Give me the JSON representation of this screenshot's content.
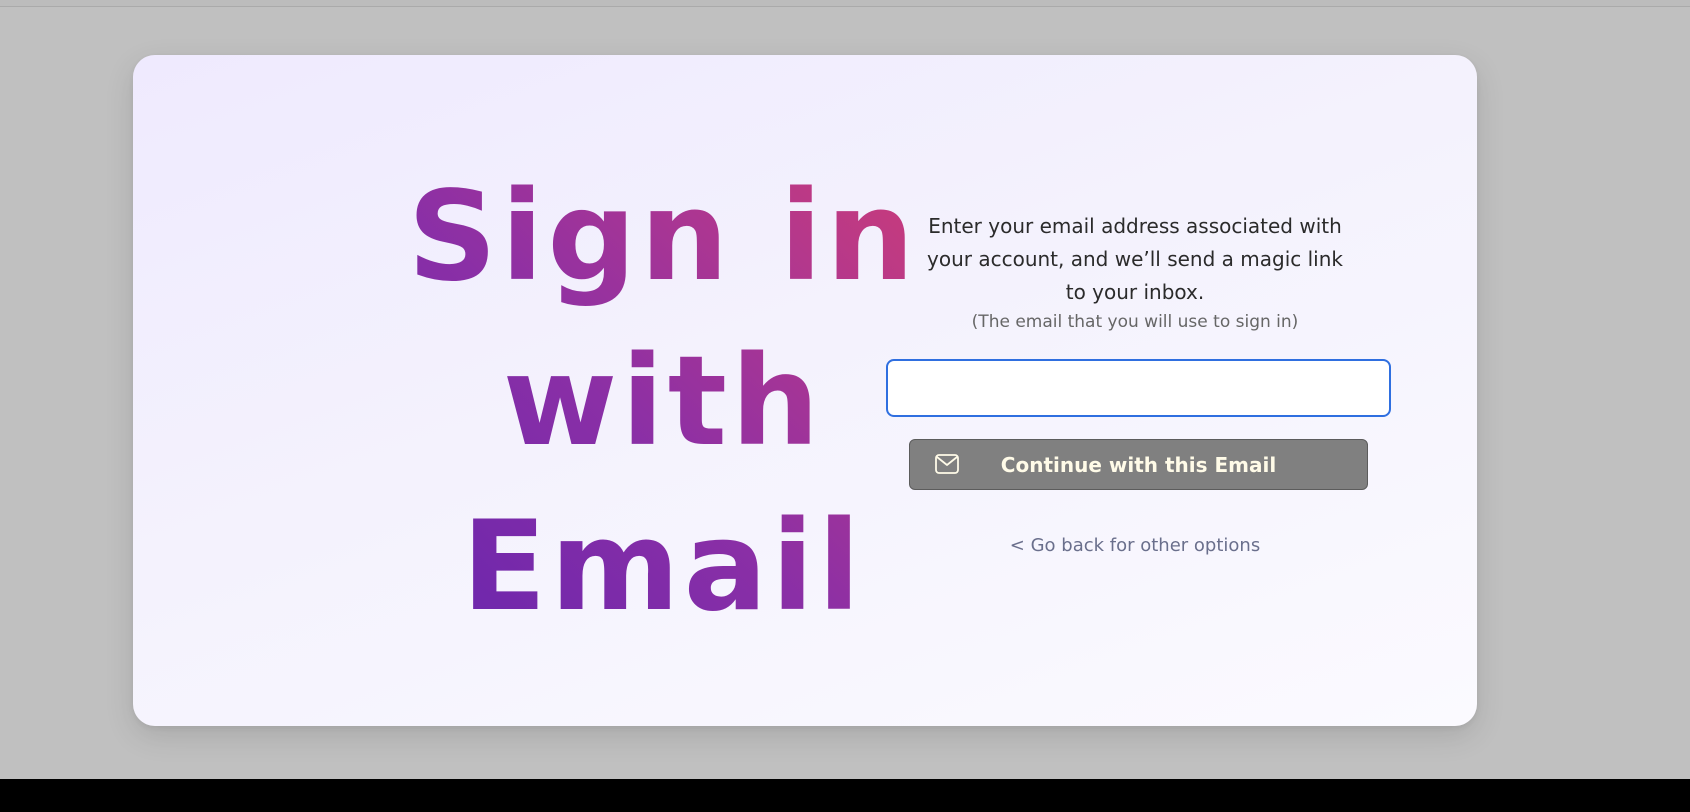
{
  "headline": {
    "line1": "Sign in",
    "line2": "with",
    "line3": "Email"
  },
  "form": {
    "description": "Enter your email address associated with your account, and we’ll send a magic link to your inbox.",
    "note": "(The email that you will use to sign in)",
    "email_value": "",
    "email_placeholder": "",
    "continue_label": "Continue with this Email",
    "continue_icon": "envelope-icon",
    "back_link": "< Go back for other options"
  },
  "colors": {
    "background": "#c0c0c0",
    "card_background": "#f4f2fd",
    "headline_gradient_start": "#5e22b0",
    "headline_gradient_end": "#da3f6c",
    "input_focus_border": "#2f6fe0",
    "button_background": "#808080",
    "button_text": "#fffbe8",
    "link_text": "#6a6f8c"
  }
}
